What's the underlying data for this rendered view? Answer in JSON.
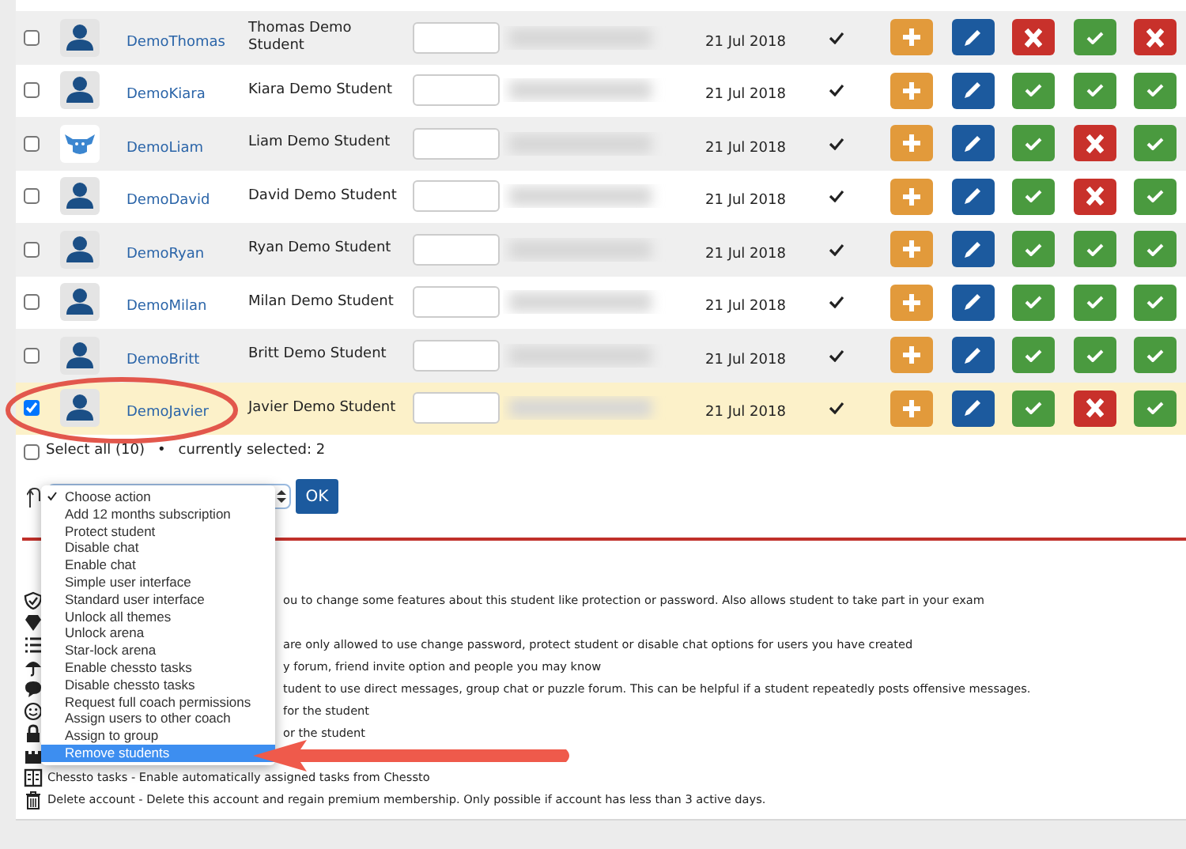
{
  "rows": [
    {
      "username": "DemoThomas",
      "name": "Thomas Demo Student",
      "date": "21 Jul 2018",
      "selected": false,
      "kind": "person",
      "toggles": [
        {
          "on": false
        },
        {
          "on": true
        },
        {
          "on": false
        }
      ]
    },
    {
      "username": "DemoKiara",
      "name": "Kiara Demo Student",
      "date": "21 Jul 2018",
      "selected": false,
      "kind": "person",
      "toggles": [
        {
          "on": true
        },
        {
          "on": true
        },
        {
          "on": true
        }
      ]
    },
    {
      "username": "DemoLiam",
      "name": "Liam Demo Student",
      "date": "21 Jul 2018",
      "selected": false,
      "kind": "mascot",
      "toggles": [
        {
          "on": true
        },
        {
          "on": false
        },
        {
          "on": true
        }
      ]
    },
    {
      "username": "DemoDavid",
      "name": "David Demo Student",
      "date": "21 Jul 2018",
      "selected": false,
      "kind": "person",
      "toggles": [
        {
          "on": true
        },
        {
          "on": false
        },
        {
          "on": true
        }
      ]
    },
    {
      "username": "DemoRyan",
      "name": "Ryan Demo Student",
      "date": "21 Jul 2018",
      "selected": false,
      "kind": "person",
      "toggles": [
        {
          "on": true
        },
        {
          "on": true
        },
        {
          "on": true
        }
      ]
    },
    {
      "username": "DemoMilan",
      "name": "Milan Demo Student",
      "date": "21 Jul 2018",
      "selected": false,
      "kind": "person",
      "toggles": [
        {
          "on": true
        },
        {
          "on": true
        },
        {
          "on": true
        }
      ]
    },
    {
      "username": "DemoBritt",
      "name": "Britt Demo Student",
      "date": "21 Jul 2018",
      "selected": false,
      "kind": "person",
      "toggles": [
        {
          "on": true
        },
        {
          "on": true
        },
        {
          "on": true
        }
      ]
    },
    {
      "username": "DemoJavier",
      "name": "Javier Demo Student",
      "date": "21 Jul 2018",
      "selected": true,
      "kind": "person",
      "toggles": [
        {
          "on": true
        },
        {
          "on": false
        },
        {
          "on": true
        }
      ]
    }
  ],
  "select_all": {
    "label": "Select all (10)",
    "checked": false,
    "separator": "•",
    "selection_count": "currently selected: 2"
  },
  "action": {
    "button": "OK"
  },
  "menu": [
    {
      "label": "Choose action",
      "checked": true,
      "highlighted": false
    },
    {
      "label": "Add 12 months subscription",
      "checked": false,
      "highlighted": false
    },
    {
      "label": "Protect student",
      "checked": false,
      "highlighted": false
    },
    {
      "label": "Disable chat",
      "checked": false,
      "highlighted": false
    },
    {
      "label": "Enable chat",
      "checked": false,
      "highlighted": false
    },
    {
      "label": "Simple user interface",
      "checked": false,
      "highlighted": false
    },
    {
      "label": "Standard user interface",
      "checked": false,
      "highlighted": false
    },
    {
      "label": "Unlock all themes",
      "checked": false,
      "highlighted": false
    },
    {
      "label": "Unlock arena",
      "checked": false,
      "highlighted": false
    },
    {
      "label": "Star-lock arena",
      "checked": false,
      "highlighted": false
    },
    {
      "label": "Enable chessto tasks",
      "checked": false,
      "highlighted": false
    },
    {
      "label": "Disable chessto tasks",
      "checked": false,
      "highlighted": false
    },
    {
      "label": "Request full coach permissions",
      "checked": false,
      "highlighted": false
    },
    {
      "label": "Assign users to other coach",
      "checked": false,
      "highlighted": false
    },
    {
      "label": "Assign to group",
      "checked": false,
      "highlighted": false
    },
    {
      "label": "Remove students",
      "checked": false,
      "highlighted": true
    }
  ],
  "legend": [
    {
      "kind": "shield",
      "text": "ou to change some features about this student like protection or password. Also allows student to take part in your exam"
    },
    {
      "kind": "diamond"
    },
    {
      "kind": "list",
      "text": "are only allowed to use change password, protect student or disable chat options for users you have created"
    },
    {
      "kind": "umbrella",
      "text": "y forum, friend invite option and people you may know"
    },
    {
      "kind": "chat",
      "text": "tudent to use direct messages, group chat or puzzle forum. This can be helpful if a student repeatedly posts offensive messages."
    },
    {
      "kind": "smiley",
      "text": "for the student"
    },
    {
      "kind": "lock",
      "text": "or the student"
    },
    {
      "kind": "castle"
    },
    {
      "kind": "book",
      "text": "Chessto tasks - Enable automatically assigned tasks from Chessto"
    },
    {
      "kind": "trash",
      "text": "Delete account - Delete this account and regain premium membership. Only possible if account has less than 3 active days."
    }
  ]
}
